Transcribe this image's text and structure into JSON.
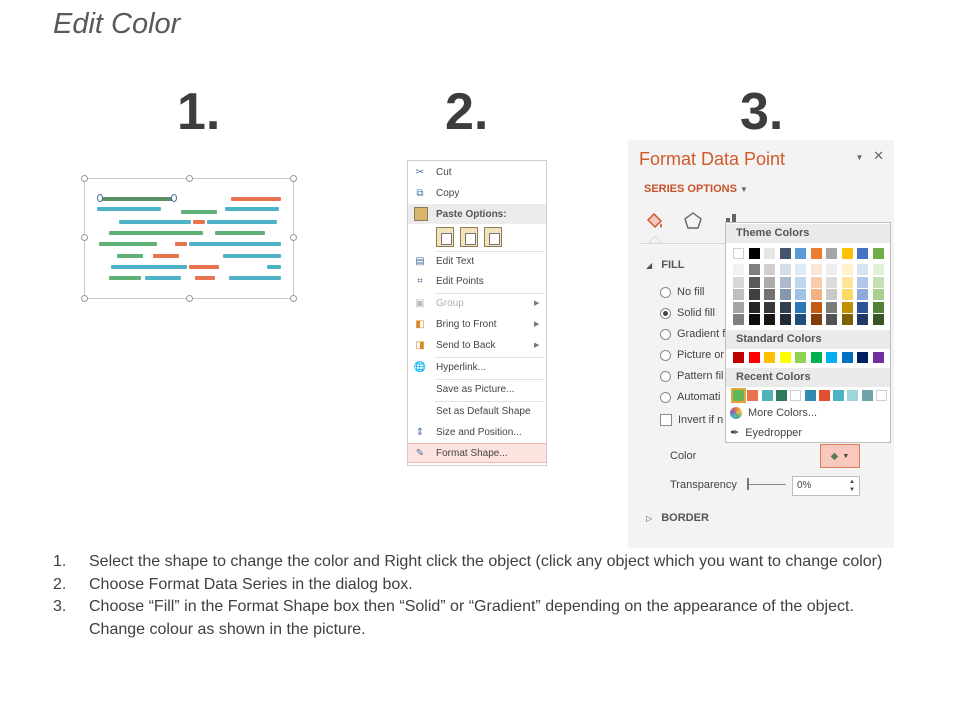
{
  "title": "Edit Color",
  "steps": [
    "1.",
    "2.",
    "3."
  ],
  "context_menu": {
    "items": [
      {
        "label": "Cut",
        "icon": "scissors-icon",
        "state": "normal"
      },
      {
        "label": "Copy",
        "icon": "copy-icon",
        "state": "normal"
      },
      {
        "label": "Paste Options:",
        "icon": "paste-icon",
        "state": "header"
      },
      {
        "label": "Edit Text",
        "icon": "edit-text-icon",
        "state": "normal"
      },
      {
        "label": "Edit Points",
        "icon": "edit-points-icon",
        "state": "normal"
      },
      {
        "label": "Group",
        "icon": "group-icon",
        "state": "disabled",
        "submenu": true
      },
      {
        "label": "Bring to Front",
        "icon": "bring-to-front-icon",
        "state": "normal",
        "submenu": true
      },
      {
        "label": "Send to Back",
        "icon": "send-to-back-icon",
        "state": "normal",
        "submenu": true
      },
      {
        "label": "Hyperlink...",
        "icon": "hyperlink-icon",
        "state": "normal"
      },
      {
        "label": "Save as Picture...",
        "icon": "",
        "state": "normal"
      },
      {
        "label": "Set as Default Shape",
        "icon": "",
        "state": "normal"
      },
      {
        "label": "Size and Position...",
        "icon": "size-position-icon",
        "state": "normal"
      },
      {
        "label": "Format Shape...",
        "icon": "format-shape-icon",
        "state": "highlighted"
      }
    ]
  },
  "format_pane": {
    "title": "Format Data Point",
    "series_options": "SERIES OPTIONS",
    "fill_header": "FILL",
    "fill_options": [
      "No fill",
      "Solid fill",
      "Gradient f",
      "Picture or",
      "Pattern fil",
      "Automati"
    ],
    "selected_fill": "Solid fill",
    "invert_label": "Invert if n",
    "color_label": "Color",
    "transparency_label": "Transparency",
    "transparency_value": "0%",
    "border_header": "BORDER"
  },
  "color_picker": {
    "theme_header": "Theme Colors",
    "standard_header": "Standard Colors",
    "recent_header": "Recent Colors",
    "more_colors": "More Colors...",
    "eyedropper": "Eyedropper",
    "theme_top": [
      "#ffffff",
      "#000000",
      "#e7e6e6",
      "#44546a",
      "#5b9bd5",
      "#ed7d31",
      "#a5a5a5",
      "#ffc000",
      "#4472c4",
      "#70ad47"
    ],
    "theme_shades": [
      [
        "#f2f2f2",
        "#7f7f7f",
        "#d0cece",
        "#d6dce4",
        "#deebf6",
        "#fbe5d5",
        "#ededed",
        "#fff2cc",
        "#d9e2f3",
        "#e2efd9"
      ],
      [
        "#d8d8d8",
        "#595959",
        "#aeabab",
        "#adb9ca",
        "#bdd7ee",
        "#f7cbac",
        "#dbdbdb",
        "#fee599",
        "#b4c6e7",
        "#c5e0b3"
      ],
      [
        "#bfbfbf",
        "#3f3f3f",
        "#757070",
        "#8496b0",
        "#9cc3e5",
        "#f4b183",
        "#c9c9c9",
        "#ffd965",
        "#8eaadb",
        "#a8d08d"
      ],
      [
        "#a5a5a5",
        "#262626",
        "#3a3838",
        "#323f4f",
        "#2e75b5",
        "#c55a11",
        "#7b7b7b",
        "#bf9000",
        "#2f5496",
        "#538135"
      ],
      [
        "#7f7f7f",
        "#0c0c0c",
        "#171616",
        "#222a35",
        "#1e4e79",
        "#833c0b",
        "#525252",
        "#7f6000",
        "#1f3864",
        "#375623"
      ]
    ],
    "standard": [
      "#c00000",
      "#ff0000",
      "#ffc000",
      "#ffff00",
      "#92d050",
      "#00b050",
      "#00b0f0",
      "#0070c0",
      "#002060",
      "#7030a0"
    ],
    "recent": [
      "#5fb85a",
      "#e8744f",
      "#4fb3b8",
      "#2f7a5a",
      "#ffffff",
      "#2e8bad",
      "#e24f2f",
      "#4fb3c8",
      "#9fd4dc",
      "#6fa5a8",
      "#ffffff"
    ]
  },
  "instructions": [
    {
      "num": "1.",
      "text": "Select the shape to change the color and Right click the object (click any object which you want to change color)"
    },
    {
      "num": "2.",
      "text": "Choose Format Data Series in the dialog box."
    },
    {
      "num": "3.",
      "text": "Choose “Fill” in the Format Shape box then “Solid” or “Gradient” depending on the appearance of the object. Change colour as shown in the picture."
    }
  ],
  "colors": {
    "accent": "#d15a2b",
    "green": "#5fb077",
    "teal": "#4fb3c8",
    "coral": "#e8744f"
  }
}
